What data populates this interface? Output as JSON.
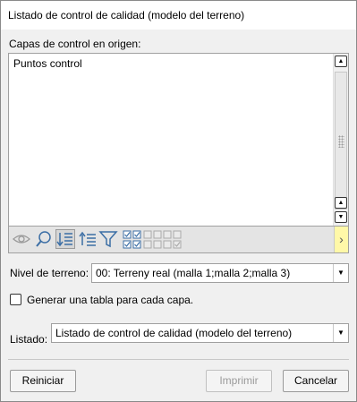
{
  "window": {
    "title": "Listado de control de calidad (modelo del terreno)"
  },
  "source_layers": {
    "label": "Capas de control en origen:",
    "items": [
      "Puntos control"
    ]
  },
  "toolbar": {
    "icons": [
      "eye-icon",
      "zoom-icon",
      "sort-descending-icon",
      "sort-ascending-icon",
      "filter-icon",
      "check-all-icon",
      "uncheck-all-icon",
      "next-arrow-icon"
    ],
    "next_glyph": "›"
  },
  "terrain_level": {
    "label": "Nivel de terreno:",
    "value": "00: Terreny real (malla 1;malla 2;malla 3)"
  },
  "per_layer_table": {
    "label": "Generar una tabla para cada capa.",
    "checked": false
  },
  "listing": {
    "label": "Listado:",
    "value": "Listado de control de calidad (modelo del terreno)"
  },
  "buttons": {
    "reset": "Reiniciar",
    "print": "Imprimir",
    "cancel": "Cancelar"
  }
}
